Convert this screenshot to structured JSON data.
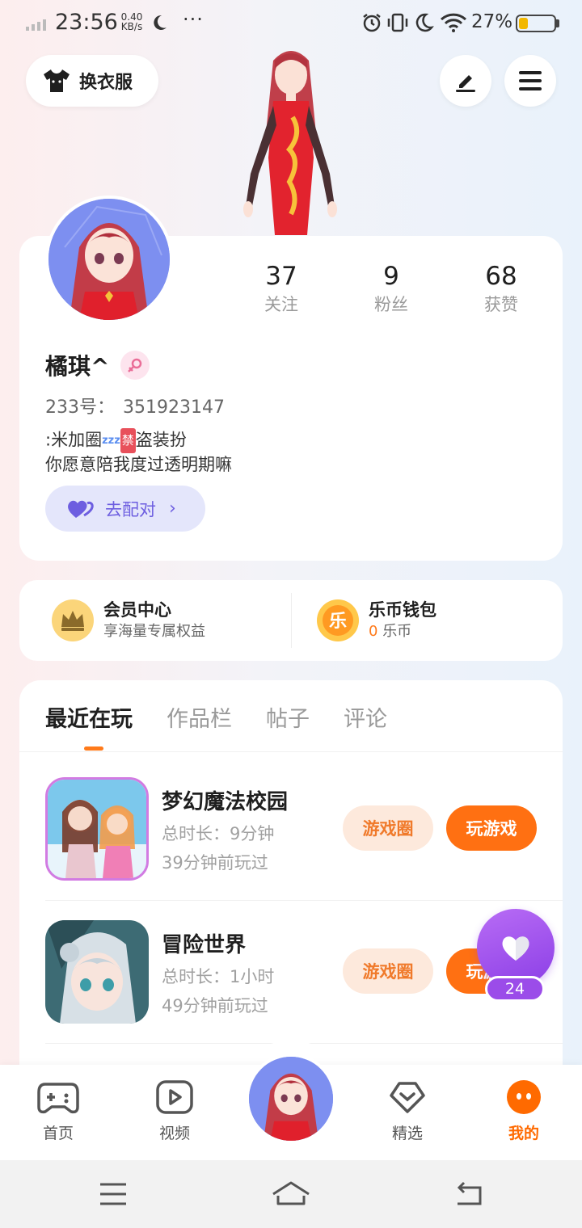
{
  "status_bar": {
    "time": "23:56",
    "net_speed_value": "0.40",
    "net_speed_unit": "KB/s",
    "more": "···",
    "battery_percent": "27%",
    "battery_level": 0.27,
    "icons": [
      "signal-icon",
      "moon-icon",
      "alarm-icon",
      "vibrate-icon",
      "moon-icon",
      "wifi-icon",
      "battery-icon"
    ]
  },
  "top": {
    "outfit_label": "换衣服",
    "edit_icon": "edit-icon",
    "menu_icon": "menu-icon"
  },
  "profile": {
    "stats": [
      {
        "value": "37",
        "label": "关注"
      },
      {
        "value": "9",
        "label": "粉丝"
      },
      {
        "value": "68",
        "label": "获赞"
      }
    ],
    "username": "橘琪^",
    "gender_icon": "female-icon",
    "id_label": "233号：",
    "id_value": "351923147",
    "bio_line1_a": ":米加圈",
    "bio_line1_zz": "zzz",
    "bio_line1_ban": "禁",
    "bio_line1_b": "盗装扮",
    "bio_line2": "你愿意陪我度过透明期嘛",
    "match_label": "去配对"
  },
  "member": {
    "vip_title": "会员中心",
    "vip_sub": "享海量专属权益",
    "wallet_title": "乐币钱包",
    "wallet_amount": "0",
    "wallet_unit": "乐币",
    "coin_glyph": "乐"
  },
  "tabs": [
    "最近在玩",
    "作品栏",
    "帖子",
    "评论"
  ],
  "games": [
    {
      "name": "梦幻魔法校园",
      "duration": "总时长：9分钟",
      "last_played": "39分钟前玩过",
      "circle_btn": "游戏圈",
      "play_btn": "玩游戏"
    },
    {
      "name": "冒险世界",
      "duration": "总时长：1小时",
      "last_played": "49分钟前玩过",
      "circle_btn": "游戏圈",
      "play_btn": "玩游戏"
    }
  ],
  "float_like": {
    "count": "24"
  },
  "bottom_nav": [
    {
      "label": "首页"
    },
    {
      "label": "视频"
    },
    {
      "label": "精选"
    },
    {
      "label": "我的"
    }
  ],
  "colors": {
    "accent": "#ff7012",
    "active_nav": "#ff6a00",
    "match": "#6d5ee0",
    "like": "#9b4ce9"
  }
}
